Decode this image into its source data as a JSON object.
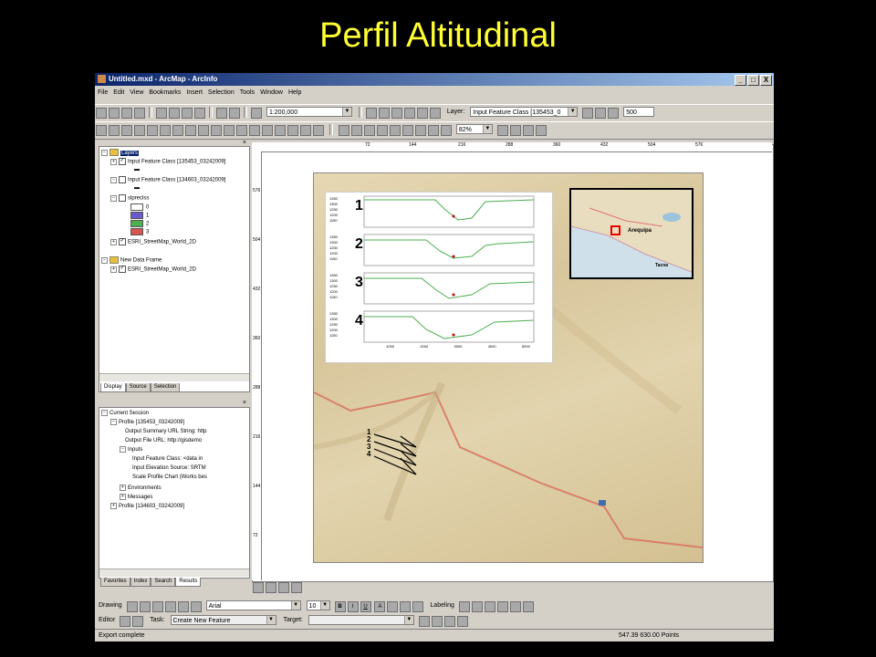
{
  "slide": {
    "title": "Perfil Altitudinal"
  },
  "window": {
    "title": "Untitled.mxd - ArcMap - ArcInfo",
    "min": "_",
    "max": "□",
    "close": "X"
  },
  "menu": [
    "File",
    "Edit",
    "View",
    "Bookmarks",
    "Insert",
    "Selection",
    "Tools",
    "Window",
    "Help"
  ],
  "toolbar": {
    "scale": "1:200,000",
    "layer_label": "Layer:",
    "layer_value": "Input Feature Class [135453_0",
    "spin_value": "500",
    "zoom_percent": "82%"
  },
  "toc": {
    "layers_label": "Layers",
    "items": [
      {
        "label": "Input Feature Class [135453_03242009]",
        "checked": true
      },
      {
        "label": "Input Feature Class [134603_03242009]",
        "checked": false
      },
      {
        "label": "slpreclss",
        "checked": false
      },
      {
        "label": "ESRI_StreetMap_World_2D",
        "checked": true
      }
    ],
    "legend": [
      {
        "label": "0",
        "color": "#ffffff"
      },
      {
        "label": "1",
        "color": "#6a5acd"
      },
      {
        "label": "2",
        "color": "#4caf50"
      },
      {
        "label": "3",
        "color": "#d9534f"
      }
    ],
    "new_frame_label": "New Data Frame",
    "new_frame_item": "ESRI_StreetMap_World_2D",
    "tabs": [
      "Display",
      "Source",
      "Selection"
    ]
  },
  "results": {
    "session": "Current Session",
    "profile1": "Profile [135453_03242009]",
    "output_summary": "Output Summary URL String: http",
    "output_file": "Output File URL: http://gisdemo",
    "inputs": "Inputs",
    "input_feature": "Input Feature Class: <data in",
    "input_elevation": "Input Elevation Source: SRTM",
    "scale_profile": "Scale Profile Chart (Works bes",
    "environments": "Environments",
    "messages": "Messages",
    "profile2": "Profile [134603_03242009]",
    "tabs": [
      "Favorites",
      "Index",
      "Search",
      "Results"
    ]
  },
  "ruler_top": [
    "72",
    "144",
    "216",
    "288",
    "360",
    "432",
    "504",
    "576"
  ],
  "ruler_left": [
    "576",
    "504",
    "432",
    "360",
    "288",
    "216",
    "144",
    "72"
  ],
  "map": {
    "profile_numbers": [
      "1",
      "2",
      "3",
      "4"
    ],
    "chart_yticks": [
      "1350",
      "1300",
      "1250",
      "1200",
      "1150"
    ],
    "chart_xticks": [
      "1000",
      "2000",
      "3000",
      "4000",
      "5000"
    ],
    "inset_city": "Arequipa",
    "inset_city2": "Tacna"
  },
  "drawing": {
    "drawing_label": "Drawing",
    "font_name": "Arial",
    "font_size": "10",
    "labeling": "Labeling",
    "bold": "B",
    "italic": "I",
    "underline": "U",
    "font_color": "A"
  },
  "editor": {
    "editor_label": "Editor",
    "task_label": "Task:",
    "task_value": "Create New Feature",
    "target_label": "Target:"
  },
  "status": {
    "left": "Export complete",
    "coords": "547.39  630.00 Points"
  }
}
